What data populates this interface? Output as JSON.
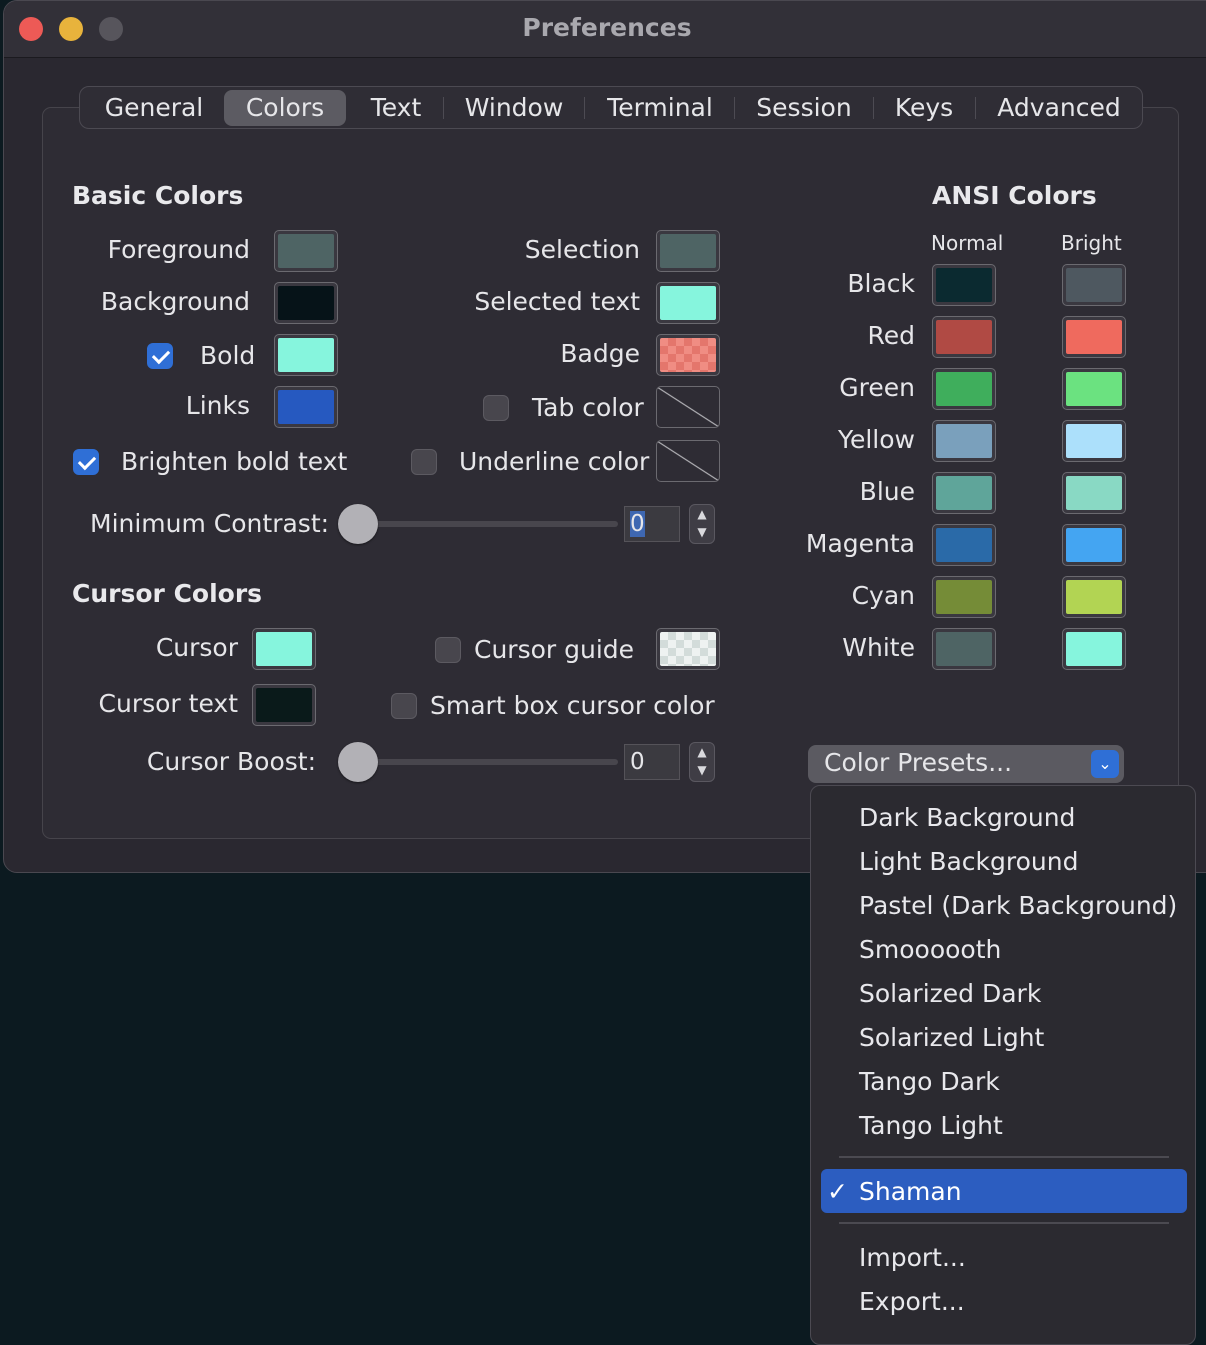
{
  "window": {
    "title": "Preferences"
  },
  "tabs": [
    "General",
    "Colors",
    "Text",
    "Window",
    "Terminal",
    "Session",
    "Keys",
    "Advanced"
  ],
  "selected_tab": "Colors",
  "basic": {
    "heading": "Basic Colors",
    "foreground": {
      "label": "Foreground",
      "color": "#4e6464"
    },
    "background": {
      "label": "Background",
      "color": "#061318"
    },
    "bold": {
      "label": "Bold",
      "checked": true,
      "color": "#86f5dd"
    },
    "links": {
      "label": "Links",
      "color": "#2659c0"
    },
    "brighten": {
      "label": "Brighten bold text",
      "checked": true
    },
    "selection": {
      "label": "Selection",
      "color": "#4e6464"
    },
    "selected_text": {
      "label": "Selected text",
      "color": "#86f5dd"
    },
    "badge": {
      "label": "Badge",
      "color": "#f08d83"
    },
    "tab_color": {
      "label": "Tab color",
      "checked": false
    },
    "underline": {
      "label": "Underline color",
      "checked": false
    },
    "min_contrast": {
      "label": "Minimum Contrast:",
      "value": "0",
      "level": 0
    }
  },
  "cursor": {
    "heading": "Cursor Colors",
    "cursor": {
      "label": "Cursor",
      "color": "#86f5dd"
    },
    "cursor_text": {
      "label": "Cursor text",
      "color": "#0a1a1a"
    },
    "guide": {
      "label": "Cursor guide",
      "checked": false
    },
    "smart": {
      "label": "Smart box cursor color",
      "checked": false
    },
    "boost": {
      "label": "Cursor Boost:",
      "value": "0",
      "level": 0
    }
  },
  "ansi": {
    "heading": "ANSI Colors",
    "normal_label": "Normal",
    "bright_label": "Bright",
    "rows": [
      {
        "label": "Black",
        "normal": "#0b2a30",
        "bright": "#4e5860"
      },
      {
        "label": "Red",
        "normal": "#b04a44",
        "bright": "#ef6a5e"
      },
      {
        "label": "Green",
        "normal": "#3fae5c",
        "bright": "#6be280"
      },
      {
        "label": "Yellow",
        "normal": "#7aa0bc",
        "bright": "#ace0fb"
      },
      {
        "label": "Blue",
        "normal": "#5fa59a",
        "bright": "#89d9c4"
      },
      {
        "label": "Magenta",
        "normal": "#2a6aa8",
        "bright": "#44a5f2"
      },
      {
        "label": "Cyan",
        "normal": "#758c37",
        "bright": "#b2d453"
      },
      {
        "label": "White",
        "normal": "#4e6464",
        "bright": "#86f5dd"
      }
    ]
  },
  "presets": {
    "button_label": "Color Presets...",
    "items": [
      "Dark Background",
      "Light Background",
      "Pastel (Dark Background)",
      "Smoooooth",
      "Solarized Dark",
      "Solarized Light",
      "Tango Dark",
      "Tango Light"
    ],
    "selected": "Shaman",
    "check": "✓",
    "actions": [
      "Import...",
      "Export..."
    ]
  },
  "icons": {
    "checkmark": "checkmark-icon",
    "chevron": "chevron-down-icon",
    "stepper": "stepper-icon"
  }
}
